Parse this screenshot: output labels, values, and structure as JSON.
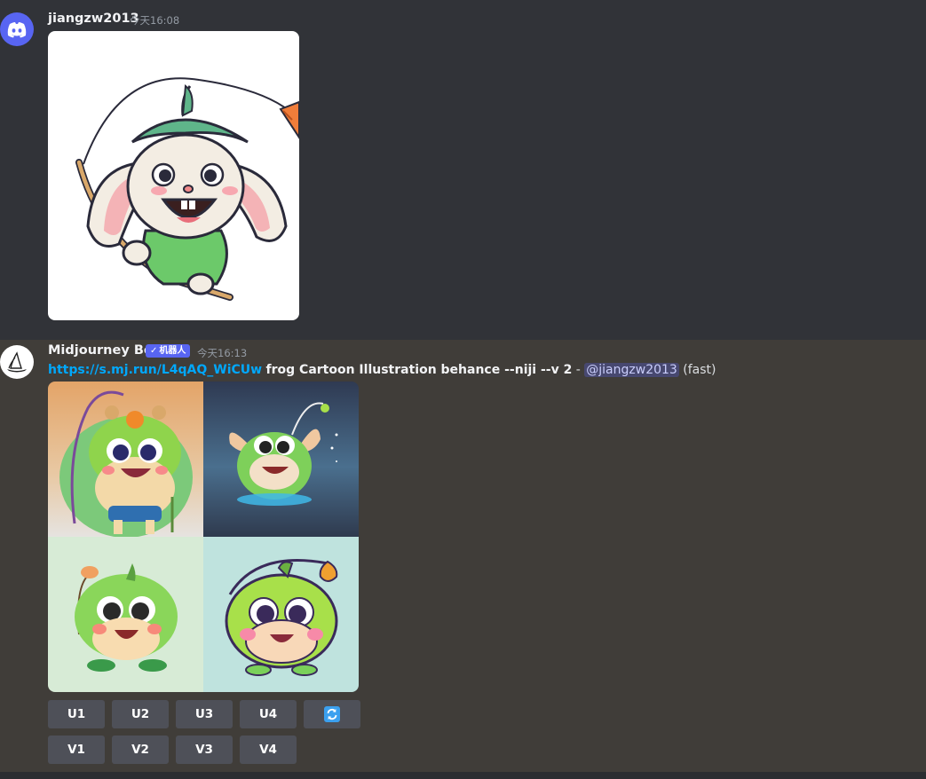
{
  "message1": {
    "author": "jiangzw2013",
    "timestamp": "今天16:08",
    "avatar_icon": "discord-logo-icon",
    "image_subject": "rabbit with leaf hat holding fishing rod with carrot"
  },
  "message2": {
    "author": "Midjourney Bot",
    "badge_check": "✓",
    "badge_label": "机器人",
    "timestamp": "今天16:13",
    "avatar_icon": "midjourney-sailboat-icon",
    "link": "https://s.mj.run/L4qAQ_WiCUw",
    "prompt": "frog Cartoon Illustration behance --niji --v 2",
    "separator": " - ",
    "mention": "@jiangzw2013",
    "speed": "(fast)",
    "upscale_buttons": [
      "U1",
      "U2",
      "U3",
      "U4"
    ],
    "variation_buttons": [
      "V1",
      "V2",
      "V3",
      "V4"
    ],
    "reroll_icon": "reroll-icon",
    "colors": {
      "accent": "#5865f2",
      "link": "#00a8fc",
      "button": "#4e5058",
      "reroll": "#3ba0ef"
    }
  }
}
